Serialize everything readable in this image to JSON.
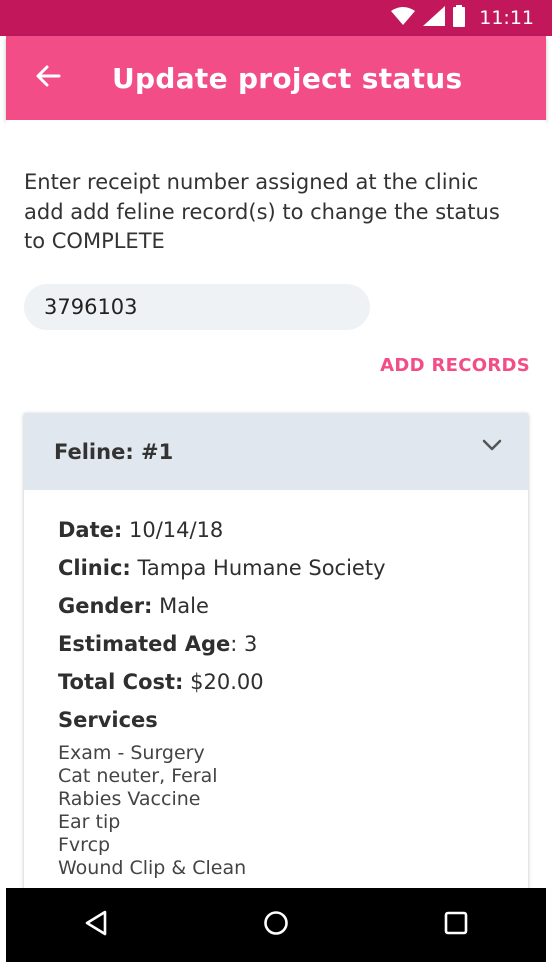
{
  "status_bar": {
    "time": "11:11"
  },
  "app_bar": {
    "title": "Update project status",
    "back_icon": "arrow-back-icon"
  },
  "instructions": "Enter receipt number assigned at the clinic add add feline record(s) to change the status to COMPLETE",
  "receipt": {
    "value": "3796103"
  },
  "add_records_label": "ADD RECORDS",
  "record": {
    "title": "Feline: #1",
    "date_label": "Date:",
    "date_value": " 10/14/18",
    "clinic_label": "Clinic:",
    "clinic_value": " Tampa Humane Society",
    "gender_label": "Gender:",
    "gender_value": " Male",
    "age_label": "Estimated Age",
    "age_value": ": 3",
    "cost_label": "Total Cost:",
    "cost_value": " $20.00",
    "services_label": "Services",
    "services": [
      "Exam - Surgery",
      "Cat neuter, Feral",
      "Rabies Vaccine",
      "Ear tip",
      "Fvrcp",
      "Wound Clip & Clean"
    ]
  },
  "colors": {
    "accent": "#f24d87",
    "status_bar": "#c2185b",
    "header_bg": "#e1e7ee"
  }
}
